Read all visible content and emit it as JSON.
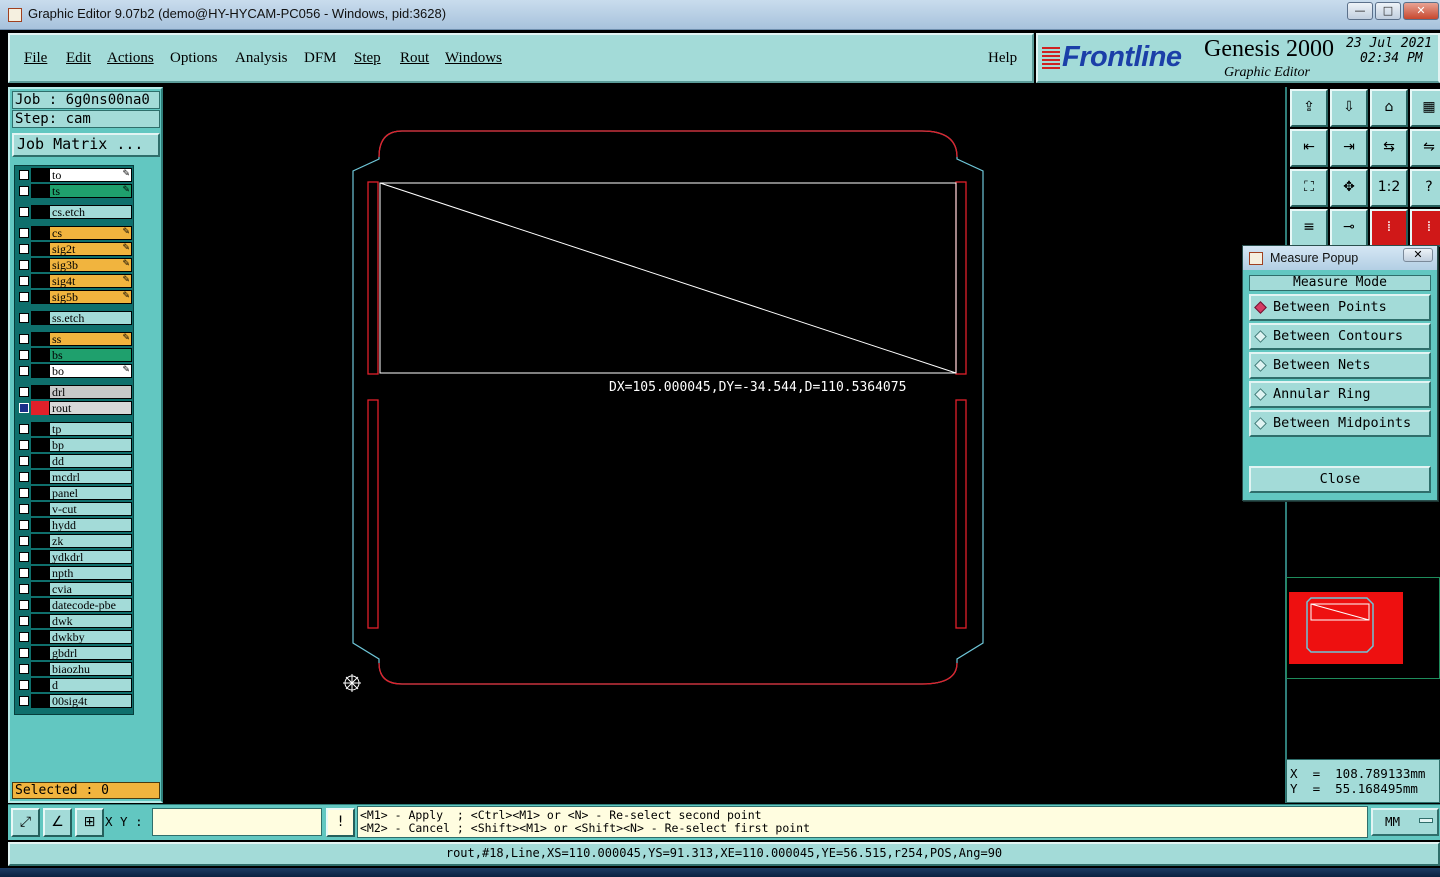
{
  "window": {
    "title": "Graphic Editor 9.07b2 (demo@HY-HYCAM-PC056 - Windows, pid:3628)",
    "minimize": "—",
    "maximize": "□",
    "close": "✕"
  },
  "menu": {
    "file": "File",
    "edit": "Edit",
    "actions": "Actions",
    "options": "Options",
    "analysis": "Analysis",
    "dfm": "DFM",
    "step": "Step",
    "rout": "Rout",
    "windows": "Windows",
    "help": "Help"
  },
  "brand": {
    "logo": "Frontline",
    "product": "Genesis 2000",
    "subtitle": "Graphic Editor",
    "date": "23 Jul 2021",
    "time": "02:34 PM"
  },
  "job": {
    "job_line": "Job : 6g0ns00na0",
    "step_line": "Step: cam",
    "matrix_button": "Job Matrix ..."
  },
  "layers": [
    {
      "name": "to",
      "color": "#ffffff",
      "editable": true,
      "selected": false
    },
    {
      "name": "ts",
      "color": "#1fa06d",
      "editable": true,
      "selected": false
    },
    {
      "name": "cs.etch",
      "color": "#a3dbd8",
      "editable": false,
      "selected": false
    },
    {
      "name": "cs",
      "color": "#f1b43e",
      "editable": true,
      "selected": false
    },
    {
      "name": "sig2t",
      "color": "#f1b43e",
      "editable": true,
      "selected": false
    },
    {
      "name": "sig3b",
      "color": "#f1b43e",
      "editable": true,
      "selected": false
    },
    {
      "name": "sig4t",
      "color": "#f1b43e",
      "editable": true,
      "selected": false
    },
    {
      "name": "sig5b",
      "color": "#f1b43e",
      "editable": true,
      "selected": false
    },
    {
      "name": "ss.etch",
      "color": "#a3dbd8",
      "editable": false,
      "selected": false
    },
    {
      "name": "ss",
      "color": "#f1b43e",
      "editable": true,
      "selected": false
    },
    {
      "name": "bs",
      "color": "#1fa06d",
      "editable": false,
      "selected": false
    },
    {
      "name": "bo",
      "color": "#ffffff",
      "editable": true,
      "selected": false
    },
    {
      "name": "drl",
      "color": "#c8c8c8",
      "editable": false,
      "selected": false
    },
    {
      "name": "rout",
      "color": "#d8d8d8",
      "editable": false,
      "selected": true
    },
    {
      "name": "tp",
      "color": "#a3dbd8",
      "editable": false,
      "selected": false
    },
    {
      "name": "bp",
      "color": "#a3dbd8",
      "editable": false,
      "selected": false
    },
    {
      "name": "dd",
      "color": "#a3dbd8",
      "editable": false,
      "selected": false
    },
    {
      "name": "mcdrl",
      "color": "#a3dbd8",
      "editable": false,
      "selected": false
    },
    {
      "name": "panel",
      "color": "#a3dbd8",
      "editable": false,
      "selected": false
    },
    {
      "name": "v-cut",
      "color": "#a3dbd8",
      "editable": false,
      "selected": false
    },
    {
      "name": "hydd",
      "color": "#a3dbd8",
      "editable": false,
      "selected": false
    },
    {
      "name": "zk",
      "color": "#a3dbd8",
      "editable": false,
      "selected": false
    },
    {
      "name": "ydkdrl",
      "color": "#a3dbd8",
      "editable": false,
      "selected": false
    },
    {
      "name": "npth",
      "color": "#a3dbd8",
      "editable": false,
      "selected": false
    },
    {
      "name": "cvia",
      "color": "#a3dbd8",
      "editable": false,
      "selected": false
    },
    {
      "name": "datecode-pbe",
      "color": "#a3dbd8",
      "editable": false,
      "selected": false
    },
    {
      "name": "dwk",
      "color": "#a3dbd8",
      "editable": false,
      "selected": false
    },
    {
      "name": "dwkby",
      "color": "#a3dbd8",
      "editable": false,
      "selected": false
    },
    {
      "name": "gbdrl",
      "color": "#a3dbd8",
      "editable": false,
      "selected": false
    },
    {
      "name": "biaozhu",
      "color": "#a3dbd8",
      "editable": false,
      "selected": false
    },
    {
      "name": "d",
      "color": "#a3dbd8",
      "editable": false,
      "selected": false
    },
    {
      "name": "00sig4t",
      "color": "#a3dbd8",
      "editable": false,
      "selected": false
    }
  ],
  "selected_count": "Selected : 0",
  "canvas": {
    "measure_result": "DX=105.000045,DY=-34.544,D=110.5364075",
    "outline_color": "#6ec6d8",
    "rout_color": "#e0202a"
  },
  "measure_popup": {
    "title": "Measure Popup",
    "close_x": "✕",
    "mode_label": "Measure Mode",
    "options": [
      {
        "label": "Between Points",
        "active": true
      },
      {
        "label": "Between Contours",
        "active": false
      },
      {
        "label": "Between Nets",
        "active": false
      },
      {
        "label": "Annular Ring",
        "active": false
      },
      {
        "label": "Between Midpoints",
        "active": false
      }
    ],
    "close_button": "Close"
  },
  "toolbar_icons": [
    "zoom-home-icon",
    "zoom-back-icon",
    "home-icon",
    "window-icon",
    "pan-left-icon",
    "pan-right-icon",
    "flip-icon",
    "swap-icon",
    "fit-icon",
    "center-icon",
    "scale-1-2-icon",
    "help-icon",
    "snap-icon",
    "pad-icon",
    "net-icon",
    "net2-icon"
  ],
  "toolbar_labels": {
    "scale": "1:2",
    "help": "?"
  },
  "coordinates": {
    "x": "X  =  108.789133mm",
    "y": "Y  =  55.168495mm"
  },
  "command": {
    "xy_label": "X Y :",
    "xy_value": "",
    "alert": "!",
    "prompt_line1": "<M1> - Apply  ; <Ctrl><M1> or <N> - Re-select second point",
    "prompt_line2": "<M2> - Cancel ; <Shift><M1> or <Shift><N> - Re-select first point",
    "units": "MM"
  },
  "status": "rout,#18,Line,XS=110.000045,YS=91.313,XE=110.000045,YE=56.515,r254,POS,Ang=90"
}
